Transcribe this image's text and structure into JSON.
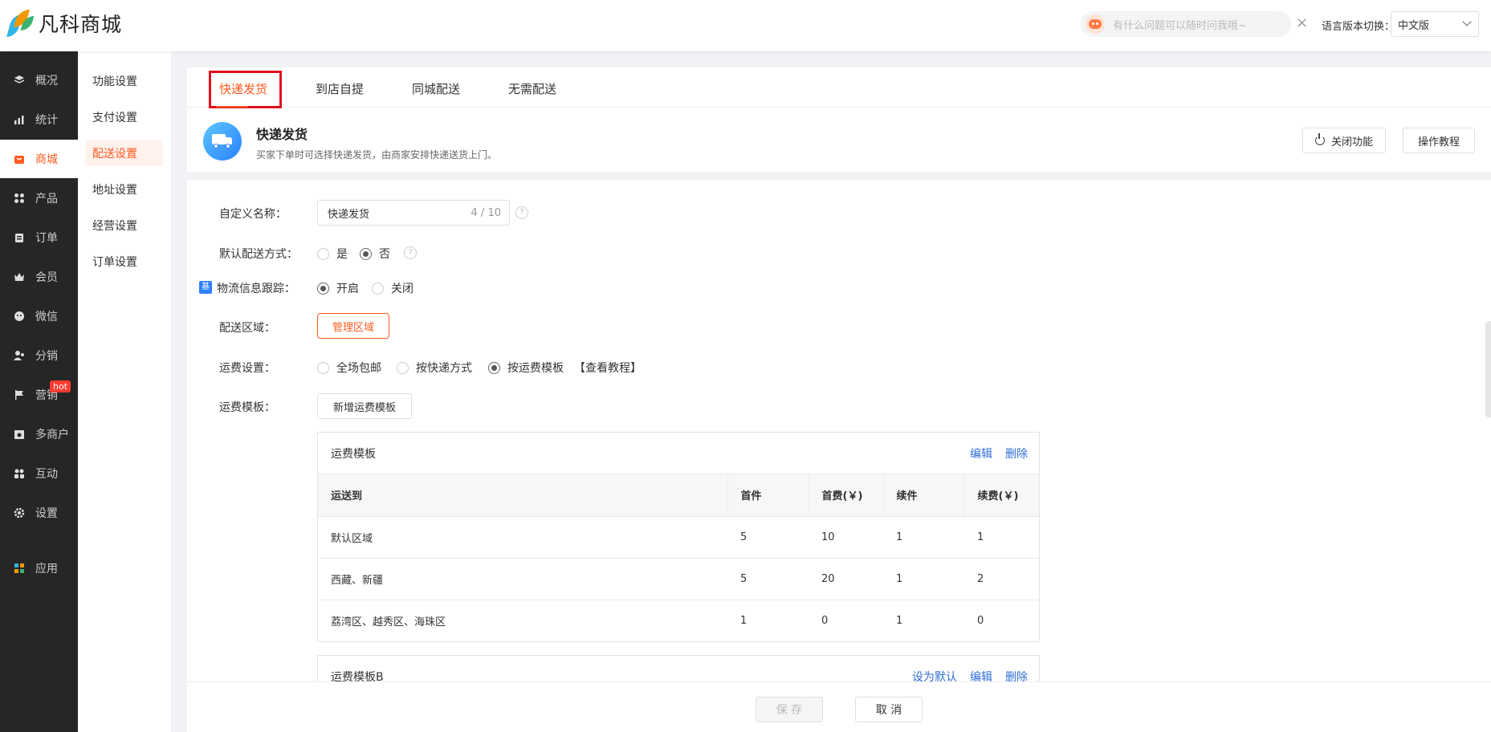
{
  "brand": {
    "name": "凡科商城"
  },
  "header": {
    "ai_placeholder": "有什么问题可以随时问我哦~",
    "close_glyph": "×",
    "lang_label": "语言版本切换：",
    "lang_value": "中文版"
  },
  "sidebar": {
    "items": [
      {
        "label": "概况",
        "icon": "layers-icon"
      },
      {
        "label": "统计",
        "icon": "chart-icon"
      },
      {
        "label": "商城",
        "icon": "mall-icon"
      },
      {
        "label": "产品",
        "icon": "grid-icon"
      },
      {
        "label": "订单",
        "icon": "clipboard-icon"
      },
      {
        "label": "会员",
        "icon": "crown-icon"
      },
      {
        "label": "微信",
        "icon": "wechat-icon"
      },
      {
        "label": "分销",
        "icon": "users-icon"
      },
      {
        "label": "营销",
        "icon": "flag-icon"
      },
      {
        "label": "多商户",
        "icon": "store-icon"
      },
      {
        "label": "互动",
        "icon": "interact-icon"
      },
      {
        "label": "设置",
        "icon": "gear-icon"
      },
      {
        "label": "应用",
        "icon": "apps-icon"
      }
    ],
    "hot_badge": "hot",
    "active": "商城"
  },
  "subsidebar": {
    "items": [
      "功能设置",
      "支付设置",
      "配送设置",
      "地址设置",
      "经营设置",
      "订单设置"
    ],
    "active": "配送设置"
  },
  "tabs": [
    "快递发货",
    "到店自提",
    "同城配送",
    "无需配送"
  ],
  "feature": {
    "title": "快递发货",
    "desc": "买家下单时可选择快递发货，由商家安排快递送货上门。",
    "close_btn": "关闭功能",
    "tutorial_btn": "操作教程"
  },
  "form": {
    "custom_name_label": "自定义名称：",
    "custom_name_value": "快递发货",
    "custom_name_count": "4 / 10",
    "help_glyph": "?",
    "default_label": "默认配送方式：",
    "default_yes": "是",
    "default_no": "否",
    "beta_badge": "基",
    "tracking_label": "物流信息跟踪：",
    "tracking_on": "开启",
    "tracking_off": "关闭",
    "area_label": "配送区域：",
    "area_btn": "管理区域",
    "fee_label": "运费设置：",
    "fee_opt1": "全场包邮",
    "fee_opt2": "按快递方式",
    "fee_opt3": "按运费模板",
    "fee_tutorial": "【查看教程】",
    "template_label": "运费模板：",
    "template_add_btn": "新增运费模板"
  },
  "templates": [
    {
      "name": "运费模板",
      "actions": [
        "编辑",
        "删除"
      ],
      "columns": [
        "运送到",
        "首件",
        "首费(￥)",
        "续件",
        "续费(￥)"
      ],
      "rows": [
        [
          "默认区域",
          "5",
          "10",
          "1",
          "1"
        ],
        [
          "西藏、新疆",
          "5",
          "20",
          "1",
          "2"
        ],
        [
          "荔湾区、越秀区、海珠区",
          "1",
          "0",
          "1",
          "0"
        ]
      ]
    },
    {
      "name": "运费模板B",
      "actions": [
        "设为默认",
        "编辑",
        "删除"
      ]
    }
  ],
  "footer": {
    "save": "保 存",
    "cancel": "取 消"
  }
}
